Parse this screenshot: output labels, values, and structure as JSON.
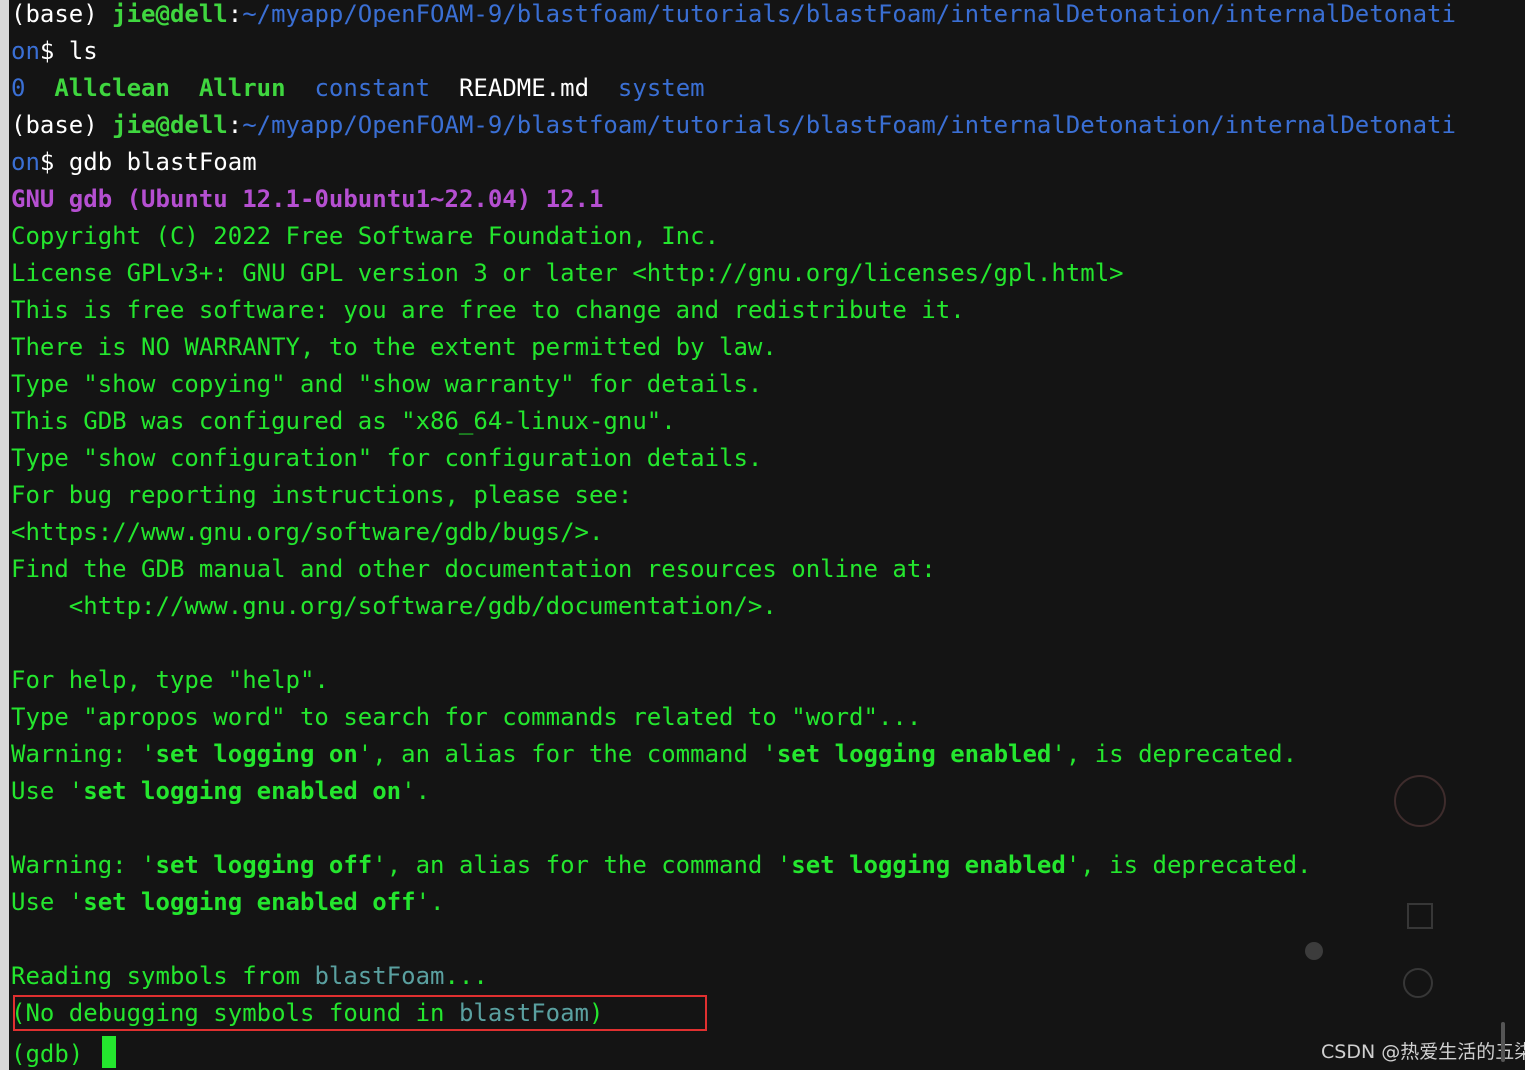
{
  "terminal": {
    "prompt_1": {
      "env": "(base) ",
      "user": "jie@dell",
      "sep": ":",
      "path": "~/myapp/OpenFOAM-9/blastfoam/tutorials/blastFoam/internalDetonation/internalDetonati",
      "path_cont": "on",
      "symbol": "$ ",
      "command": "ls"
    },
    "ls_output": [
      {
        "name": "0",
        "kind": "dir"
      },
      {
        "name": "Allclean",
        "kind": "exec"
      },
      {
        "name": "Allrun",
        "kind": "exec"
      },
      {
        "name": "constant",
        "kind": "dir"
      },
      {
        "name": "README.md",
        "kind": "file"
      },
      {
        "name": "system",
        "kind": "dir"
      }
    ],
    "prompt_2": {
      "env": "(base) ",
      "user": "jie@dell",
      "sep": ":",
      "path": "~/myapp/OpenFOAM-9/blastfoam/tutorials/blastFoam/internalDetonation/internalDetonati",
      "path_cont": "on",
      "symbol": "$ ",
      "command": "gdb blastFoam"
    },
    "gdb_banner": {
      "name": "GNU gdb",
      "version_paren": "(Ubuntu 12.1-0ubuntu1~22.04)",
      "version": "12.1"
    },
    "gdb_lines": [
      "Copyright (C) 2022 Free Software Foundation, Inc.",
      "License GPLv3+: GNU GPL version 3 or later <http://gnu.org/licenses/gpl.html>",
      "This is free software: you are free to change and redistribute it.",
      "There is NO WARRANTY, to the extent permitted by law.",
      "Type \"show copying\" and \"show warranty\" for details.",
      "This GDB was configured as \"x86_64-linux-gnu\".",
      "Type \"show configuration\" for configuration details.",
      "For bug reporting instructions, please see:",
      "<https://www.gnu.org/software/gdb/bugs/>.",
      "Find the GDB manual and other documentation resources online at:",
      "    <http://www.gnu.org/software/gdb/documentation/>."
    ],
    "help_lines": [
      "For help, type \"help\".",
      "Type \"apropos word\" to search for commands related to \"word\"..."
    ],
    "warning_on": {
      "prefix": "Warning: '",
      "cmd": "set logging on",
      "mid": "', an alias for the command '",
      "cmd2": "set logging enabled",
      "suffix": "', is deprecated."
    },
    "use_on": {
      "prefix": "Use '",
      "cmd": "set logging enabled on",
      "suffix": "'."
    },
    "warning_off": {
      "prefix": "Warning: '",
      "cmd": "set logging off",
      "mid": "', an alias for the command '",
      "cmd2": "set logging enabled",
      "suffix": "', is deprecated."
    },
    "use_off": {
      "prefix": "Use '",
      "cmd": "set logging enabled off",
      "suffix": "'."
    },
    "reading": {
      "prefix": "Reading symbols from ",
      "file": "blastFoam",
      "suffix": "..."
    },
    "no_symbols": {
      "prefix": "(No debugging symbols found in ",
      "file": "blastFoam",
      "suffix": ")"
    },
    "gdb_prompt": "(gdb) "
  },
  "watermark": "CSDN @热爱生活的五柒",
  "colors": {
    "background": "#141414",
    "text_green": "#24e62e",
    "path_blue": "#3a6fd4",
    "gdb_purple": "#b54fd1",
    "highlight_red": "#e03030"
  }
}
